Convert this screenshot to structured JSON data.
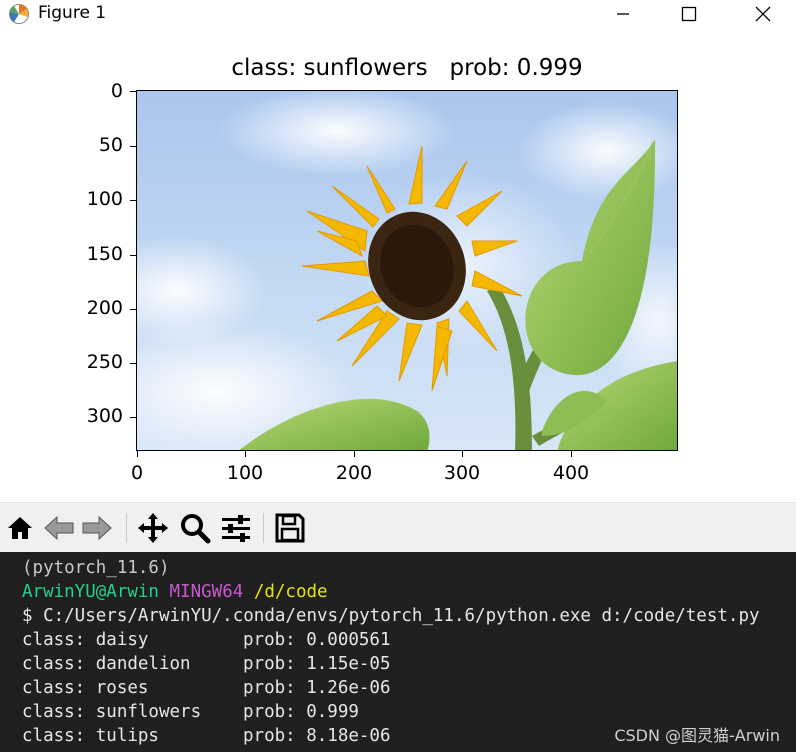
{
  "window": {
    "title": "Figure 1",
    "controls": [
      "minimize-icon",
      "maximize-icon",
      "close-icon"
    ]
  },
  "figure": {
    "title": "class: sunflowers   prob: 0.999",
    "yticks": [
      "0",
      "50",
      "100",
      "150",
      "200",
      "250",
      "300"
    ],
    "xticks": [
      "0",
      "100",
      "200",
      "300",
      "400"
    ]
  },
  "toolbar": {
    "tools": [
      "home-icon",
      "back-arrow-icon",
      "forward-arrow-icon",
      "pan-move-icon",
      "zoom-magnifier-icon",
      "configure-subplots-icon",
      "save-floppy-icon"
    ]
  },
  "terminal": {
    "env": "(pytorch_11.6)",
    "user": "ArwinYU@Arwin",
    "system": "MINGW64",
    "path": "/d/code",
    "command": "$ C:/Users/ArwinYU/.conda/envs/pytorch_11.6/python.exe d:/code/test.py",
    "results": [
      {
        "cls": "class: daisy",
        "prob": "prob: 0.000561"
      },
      {
        "cls": "class: dandelion",
        "prob": "prob: 1.15e-05"
      },
      {
        "cls": "class: roses",
        "prob": "prob: 1.26e-06"
      },
      {
        "cls": "class: sunflowers",
        "prob": "prob: 0.999"
      },
      {
        "cls": "class: tulips",
        "prob": "prob: 8.18e-06"
      }
    ]
  },
  "watermark": "CSDN @图灵猫-Arwin"
}
